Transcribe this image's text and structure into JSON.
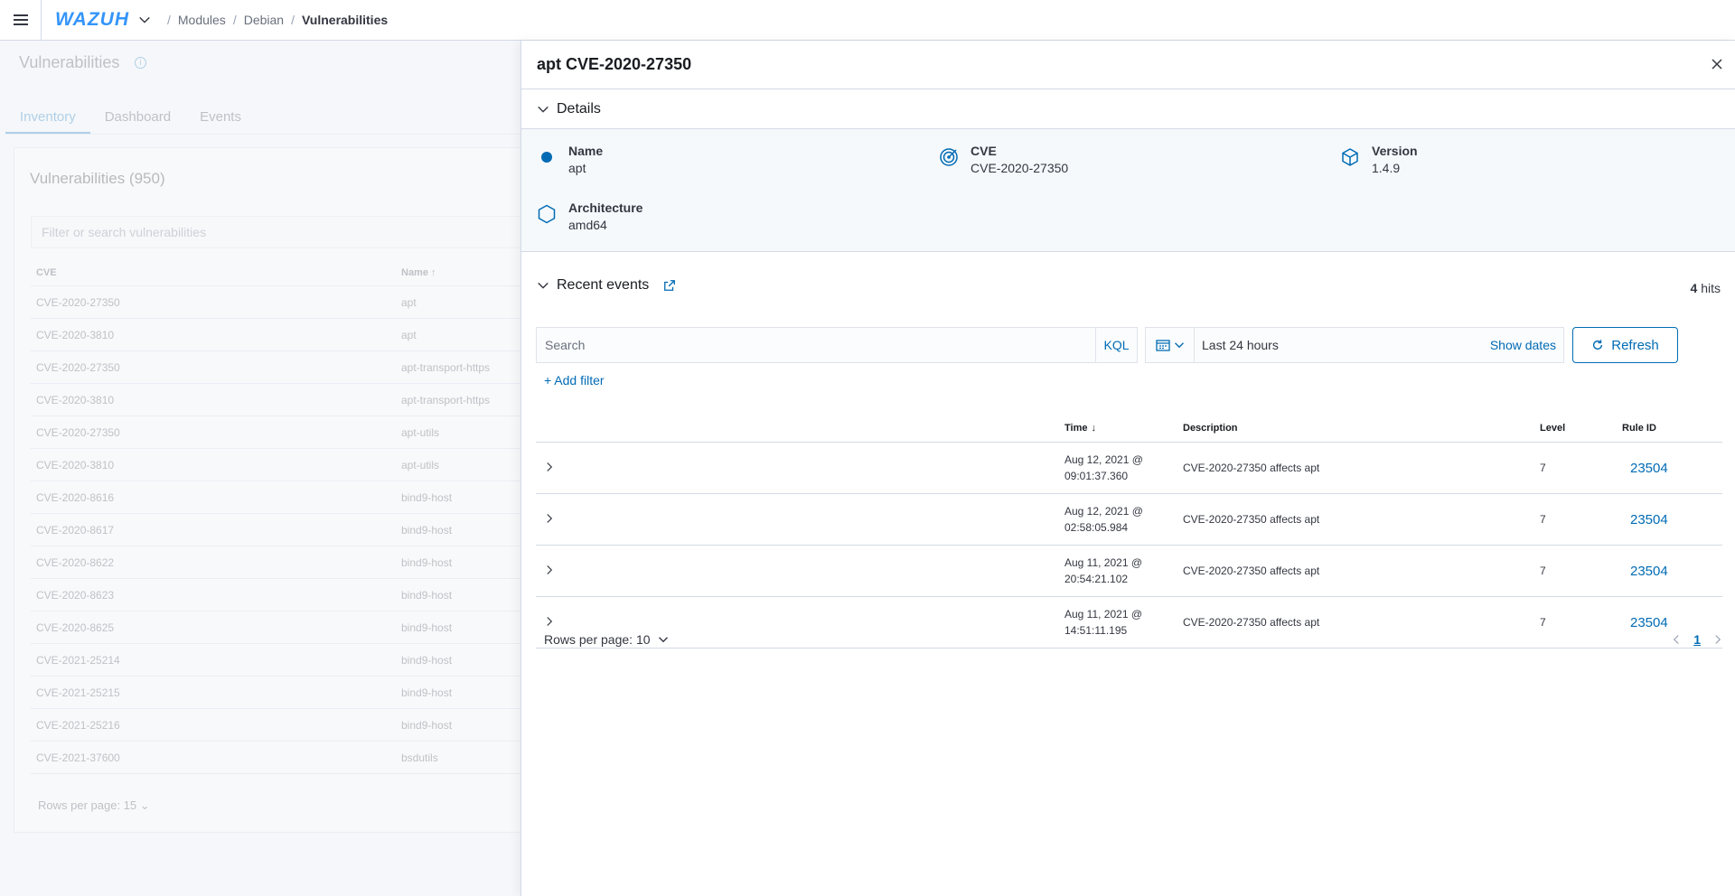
{
  "header": {
    "logo": "WAZUH",
    "breadcrumbs": [
      "Modules",
      "Debian",
      "Vulnerabilities"
    ]
  },
  "background": {
    "title": "Vulnerabilities",
    "tabs": [
      "Inventory",
      "Dashboard",
      "Events"
    ],
    "panel_title": "Vulnerabilities (950)",
    "search_placeholder": "Filter or search vulnerabilities",
    "columns": [
      "CVE",
      "Name"
    ],
    "rows": [
      [
        "CVE-2020-27350",
        "apt"
      ],
      [
        "CVE-2020-3810",
        "apt"
      ],
      [
        "CVE-2020-27350",
        "apt-transport-https"
      ],
      [
        "CVE-2020-3810",
        "apt-transport-https"
      ],
      [
        "CVE-2020-27350",
        "apt-utils"
      ],
      [
        "CVE-2020-3810",
        "apt-utils"
      ],
      [
        "CVE-2020-8616",
        "bind9-host"
      ],
      [
        "CVE-2020-8617",
        "bind9-host"
      ],
      [
        "CVE-2020-8622",
        "bind9-host"
      ],
      [
        "CVE-2020-8623",
        "bind9-host"
      ],
      [
        "CVE-2020-8625",
        "bind9-host"
      ],
      [
        "CVE-2021-25214",
        "bind9-host"
      ],
      [
        "CVE-2021-25215",
        "bind9-host"
      ],
      [
        "CVE-2021-25216",
        "bind9-host"
      ],
      [
        "CVE-2021-37600",
        "bsdutils"
      ]
    ],
    "rows_per_page": "Rows per page: 15"
  },
  "flyout": {
    "title": "apt CVE-2020-27350",
    "details_label": "Details",
    "details": {
      "name_label": "Name",
      "name_value": "apt",
      "cve_label": "CVE",
      "cve_value": "CVE-2020-27350",
      "version_label": "Version",
      "version_value": "1.4.9",
      "arch_label": "Architecture",
      "arch_value": "amd64"
    },
    "recent_events_label": "Recent events",
    "hits_count": "4",
    "hits_label": "hits",
    "search_placeholder": "Search",
    "kql": "KQL",
    "date_range": "Last 24 hours",
    "show_dates": "Show dates",
    "refresh": "Refresh",
    "add_filter": "+ Add filter",
    "columns": {
      "time": "Time",
      "description": "Description",
      "level": "Level",
      "rule_id": "Rule ID"
    },
    "events": [
      {
        "time_date": "Aug 12, 2021 @",
        "time_clock": "09:01:37.360",
        "description": "CVE-2020-27350 affects apt",
        "level": "7",
        "rule_id": "23504"
      },
      {
        "time_date": "Aug 12, 2021 @",
        "time_clock": "02:58:05.984",
        "description": "CVE-2020-27350 affects apt",
        "level": "7",
        "rule_id": "23504"
      },
      {
        "time_date": "Aug 11, 2021 @",
        "time_clock": "20:54:21.102",
        "description": "CVE-2020-27350 affects apt",
        "level": "7",
        "rule_id": "23504"
      },
      {
        "time_date": "Aug 11, 2021 @",
        "time_clock": "14:51:11.195",
        "description": "CVE-2020-27350 affects apt",
        "level": "7",
        "rule_id": "23504"
      }
    ],
    "rows_per_page": "Rows per page: 10",
    "current_page": "1"
  },
  "colors": {
    "accent": "#006bb4",
    "brand": "#3595f9",
    "border": "#d3dae6"
  }
}
